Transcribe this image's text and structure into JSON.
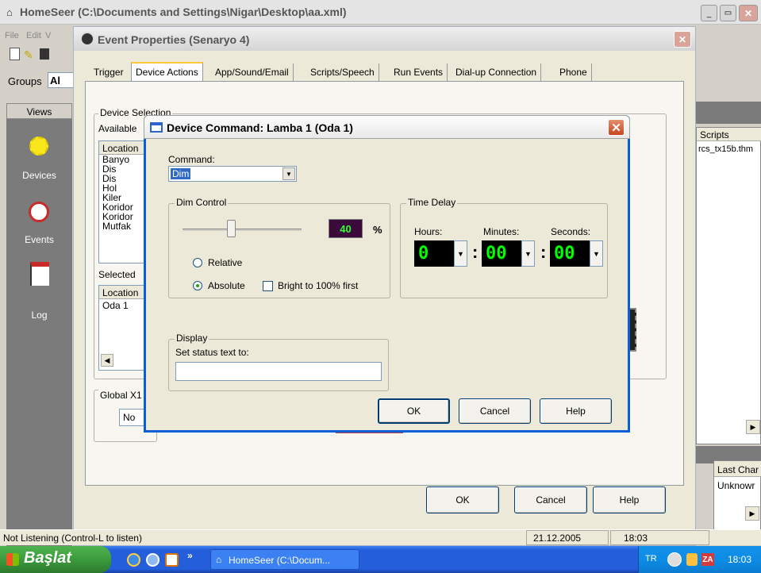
{
  "main_window": {
    "title": "HomeSeer (C:\\Documents and Settings\\Nigar\\Desktop\\aa.xml)",
    "menu": [
      "File",
      "Edit",
      "V"
    ],
    "groups_label": "Groups",
    "groups_value": "Al",
    "views_header": "Views",
    "side_nav": [
      {
        "label": "Devices",
        "icon": "lightbulb-icon"
      },
      {
        "label": "Events",
        "icon": "clock-icon"
      },
      {
        "label": "Log",
        "icon": "log-book-icon"
      }
    ],
    "scripts_header": "Scripts",
    "scripts_item": "rcs_tx15b.thm",
    "last_change_header": "Last Char",
    "last_change_value": "Unknowr"
  },
  "event_dialog": {
    "title": "Event Properties (Senaryo 4)",
    "tabs": [
      "Trigger",
      "Device Actions",
      "App/Sound/Email",
      "Scripts/Speech",
      "Run Events",
      "Dial-up Connection",
      "Phone"
    ],
    "active_tab": "Device Actions",
    "device_selection_label": "Device Selection",
    "available_label": "Available",
    "location_header": "Location",
    "available_items": [
      "Banyo",
      "Dis",
      "Dis",
      "Hol",
      "Kiler",
      "Koridor",
      "Koridor",
      "Mutfak"
    ],
    "selected_label": "Selected",
    "selected_header": "Location",
    "selected_items": [
      "Oda 1"
    ],
    "global_label": "Global X1",
    "global_value": "No",
    "ok": "OK",
    "cancel": "Cancel",
    "help": "Help"
  },
  "device_command_dialog": {
    "title": "Device Command: Lamba 1 (Oda 1)",
    "command_label": "Command:",
    "command_value": "Dim",
    "dim_control_label": "Dim Control",
    "dim_value": "40",
    "dim_level": 0.4,
    "percent": "%",
    "relative_label": "Relative",
    "absolute_label": "Absolute",
    "bright_label": "Bright to 100% first",
    "time_delay_label": "Time Delay",
    "hours_label": "Hours:",
    "minutes_label": "Minutes:",
    "seconds_label": "Seconds:",
    "hours_value": "0",
    "minutes_value": "00",
    "seconds_value": "00",
    "colon": ":",
    "display_label": "Display",
    "status_text_label": "Set status text to:",
    "status_text_value": "",
    "ok": "OK",
    "cancel": "Cancel",
    "help": "Help"
  },
  "status_bar": {
    "message": "Not Listening (Control-L to listen)",
    "date": "21.12.2005",
    "time": "18:03"
  },
  "taskbar": {
    "start_label": "Başlat",
    "task_label": "HomeSeer (C:\\Docum...",
    "language": "TR",
    "clock": "18:03",
    "chevron": "»"
  },
  "colors": {
    "dialog_bg": "#ece9d8",
    "xp_blue": "#0a5fd8",
    "led_green": "#00ff00",
    "taskbar_blue": "#245edb",
    "start_green": "#3c9a3c"
  }
}
